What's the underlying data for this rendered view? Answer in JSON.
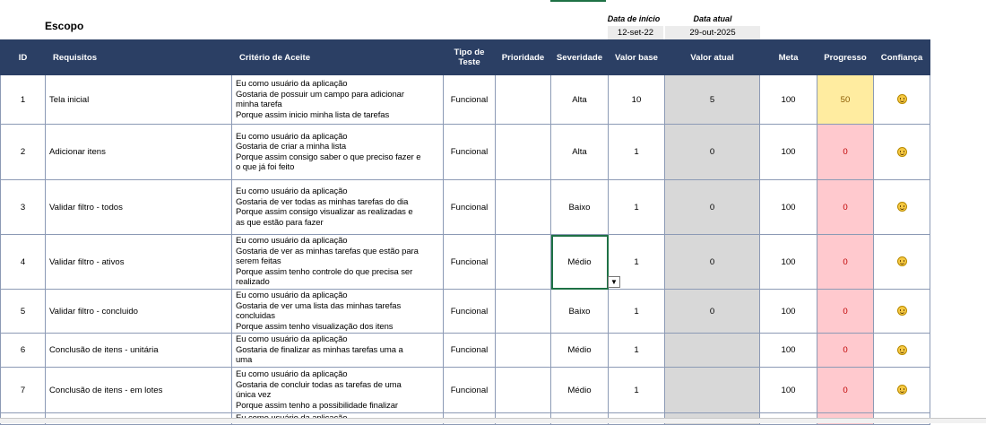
{
  "scope_title": "Escopo",
  "dates": {
    "start_label": "Data de início",
    "start_value": "12-set-22",
    "current_label": "Data atual",
    "current_value": "29-out-2025"
  },
  "headers": {
    "id": "ID",
    "requisitos": "Requisitos",
    "criterio": "Critério de Aceite",
    "tipo": "Tipo de Teste",
    "prioridade": "Prioridade",
    "severidade": "Severidade",
    "valor_base": "Valor base",
    "valor_atual": "Valor atual",
    "meta": "Meta",
    "progresso": "Progresso",
    "confianca": "Confiança"
  },
  "rows": [
    {
      "id": "1",
      "requisito": "Tela inicial",
      "criterio": [
        "Eu como usuário da aplicação",
        "Gostaria de possuir um campo para adicionar",
        "minha tarefa",
        "Porque assim inicio minha lista de tarefas"
      ],
      "tipo": "Funcional",
      "prioridade": "",
      "severidade": "Alta",
      "valor_base": "10",
      "valor_atual": "5",
      "meta": "100",
      "progresso": "50",
      "progresso_status": "yellow"
    },
    {
      "id": "2",
      "requisito": "Adicionar itens",
      "criterio": [
        "Eu como usuário da aplicação",
        "Gostaria de criar a minha lista",
        "Porque assim consigo saber o que preciso fazer e",
        "o que já foi feito"
      ],
      "tipo": "Funcional",
      "prioridade": "",
      "severidade": "Alta",
      "valor_base": "1",
      "valor_atual": "0",
      "meta": "100",
      "progresso": "0",
      "progresso_status": "pink"
    },
    {
      "id": "3",
      "requisito": "Validar filtro - todos",
      "criterio": [
        "Eu como usuário da aplicação",
        "Gostaria de ver todas as minhas tarefas do dia",
        "Porque assim consigo visualizar as realizadas e",
        "as que estão para fazer"
      ],
      "tipo": "Funcional",
      "prioridade": "",
      "severidade": "Baixo",
      "valor_base": "1",
      "valor_atual": "0",
      "meta": "100",
      "progresso": "0",
      "progresso_status": "pink"
    },
    {
      "id": "4",
      "requisito": "Validar filtro - ativos",
      "criterio": [
        "Eu como usuário da aplicação",
        "Gostaria de ver as minhas tarefas que estão para",
        "serem feitas",
        "Porque assim tenho controle do que precisa ser",
        "realizado"
      ],
      "tipo": "Funcional",
      "prioridade": "",
      "severidade": "Médio",
      "valor_base": "1",
      "valor_atual": "0",
      "meta": "100",
      "progresso": "0",
      "progresso_status": "pink"
    },
    {
      "id": "5",
      "requisito": "Validar filtro - concluido",
      "criterio": [
        "Eu como usuário da aplicação",
        "Gostaria de ver uma lista das minhas tarefas",
        "concluidas",
        "Porque assim tenho visualização dos itens"
      ],
      "tipo": "Funcional",
      "prioridade": "",
      "severidade": "Baixo",
      "valor_base": "1",
      "valor_atual": "0",
      "meta": "100",
      "progresso": "0",
      "progresso_status": "pink"
    },
    {
      "id": "6",
      "requisito": "Conclusão de itens - unitária",
      "criterio": [
        "Eu como usuário da aplicação",
        "Gostaria de finalizar as minhas tarefas uma a",
        "uma"
      ],
      "tipo": "Funcional",
      "prioridade": "",
      "severidade": "Médio",
      "valor_base": "1",
      "valor_atual": "",
      "meta": "100",
      "progresso": "0",
      "progresso_status": "pink"
    },
    {
      "id": "7",
      "requisito": "Conclusão de itens - em lotes",
      "criterio": [
        "Eu como usuário da aplicação",
        "Gostaria de concluir todas as tarefas de uma",
        "única vez",
        "Porque assim tenho a possibilidade finalizar"
      ],
      "tipo": "Funcional",
      "prioridade": "",
      "severidade": "Médio",
      "valor_base": "1",
      "valor_atual": "",
      "meta": "100",
      "progresso": "0",
      "progresso_status": "pink"
    },
    {
      "id": "",
      "requisito": "",
      "criterio": [
        "Eu como usuário da aplicação"
      ],
      "tipo": "",
      "prioridade": "",
      "severidade": "",
      "valor_base": "",
      "valor_atual": "",
      "meta": "",
      "progresso": "",
      "progresso_status": "pink"
    }
  ],
  "colors": {
    "header_bg": "#2b3f64",
    "selection": "#1e7145",
    "progress_yellow": "#ffeca0",
    "progress_pink": "#ffc9ce"
  }
}
